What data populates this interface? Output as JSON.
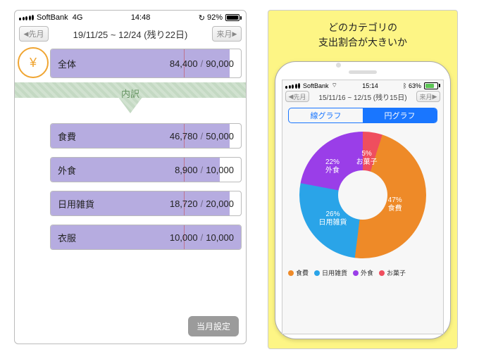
{
  "left": {
    "status": {
      "carrier": "SoftBank",
      "network": "4G",
      "time": "14:48",
      "battery": "92%"
    },
    "nav": {
      "prev": "先月",
      "next": "来月",
      "range": "19/11/25 ~ 12/24 (残り22日)"
    },
    "total": {
      "label": "全体",
      "spent": "84,400",
      "budget": "90,000",
      "fill_pct": 94,
      "icon_glyph": "¥"
    },
    "breakdown_label": "内訳",
    "categories": [
      {
        "id": "food",
        "label": "食費",
        "spent": "46,780",
        "budget": "50,000",
        "fill_pct": 94,
        "color": "#ee8a28",
        "glyph": "🍚"
      },
      {
        "id": "eatout",
        "label": "外食",
        "spent": "8,900",
        "budget": "10,000",
        "fill_pct": 89,
        "color": "#9a3ee8",
        "glyph": "🍴"
      },
      {
        "id": "daily",
        "label": "日用雑貨",
        "spent": "18,720",
        "budget": "20,000",
        "fill_pct": 94,
        "color": "#2aa4e8",
        "glyph": "🧻"
      },
      {
        "id": "clothes",
        "label": "衣服",
        "spent": "10,000",
        "budget": "10,000",
        "fill_pct": 100,
        "color": "#38c649",
        "glyph": "👕"
      }
    ],
    "settings_label": "当月設定"
  },
  "right": {
    "title_l1": "どのカテゴリの",
    "title_l2": "支出割合が大きいか",
    "status": {
      "carrier": "SoftBank",
      "time": "15:14",
      "battery": "63%"
    },
    "nav": {
      "prev": "先月",
      "next": "来月",
      "range": "15/11/16 ~ 12/15 (残り15日)"
    },
    "seg": {
      "line": "線グラフ",
      "pie": "円グラフ"
    },
    "legend": [
      {
        "label": "食費",
        "color": "#ee8a28"
      },
      {
        "label": "日用雑貨",
        "color": "#2aa4e8"
      },
      {
        "label": "外食",
        "color": "#9a3ee8"
      },
      {
        "label": "お菓子",
        "color": "#ef4e5e"
      }
    ]
  },
  "chart_data": {
    "type": "pie",
    "title": "支出割合",
    "series": [
      {
        "name": "お菓子",
        "value": 5,
        "color": "#ef4e5e"
      },
      {
        "name": "食費",
        "value": 47,
        "color": "#ee8a28"
      },
      {
        "name": "日用雑貨",
        "value": 26,
        "color": "#2aa4e8"
      },
      {
        "name": "外食",
        "value": 22,
        "color": "#9a3ee8"
      }
    ],
    "unit": "%"
  }
}
